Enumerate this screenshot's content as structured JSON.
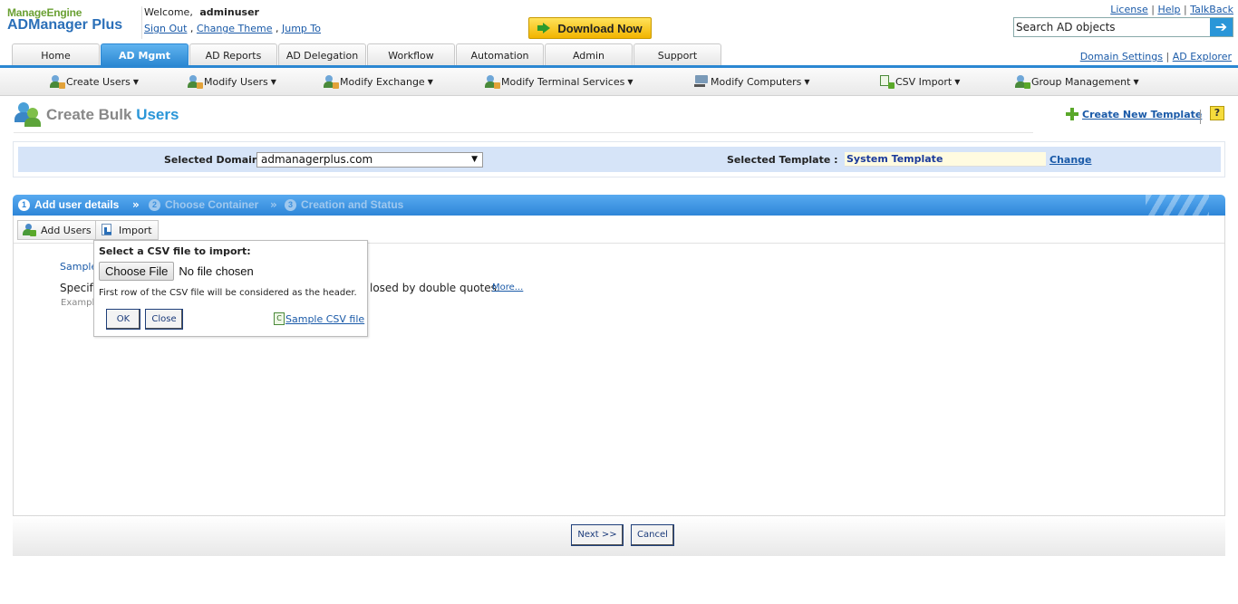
{
  "logo": {
    "top": "ManageEngine",
    "main": "ADManager",
    "plus": "Plus"
  },
  "welcome": {
    "text": "Welcome,",
    "user": "adminuser",
    "sign_out": "Sign Out",
    "sep1": " , ",
    "change_theme": "Change Theme",
    "sep2": " , ",
    "jump_to": "Jump To"
  },
  "download_label": "Download Now",
  "top_links": {
    "license": "License",
    "help": "Help",
    "talkback": "TalkBack",
    "sep": " | "
  },
  "search": {
    "value": "Search AD objects",
    "go_icon": "arrow-right-icon"
  },
  "tabs": [
    {
      "label": "Home"
    },
    {
      "label": "AD Mgmt"
    },
    {
      "label": "AD Reports"
    },
    {
      "label": "AD Delegation"
    },
    {
      "label": "Workflow"
    },
    {
      "label": "Automation"
    },
    {
      "label": "Admin"
    },
    {
      "label": "Support"
    }
  ],
  "tab_links": {
    "domain_settings": "Domain Settings",
    "sep": " | ",
    "ad_explorer": "AD Explorer"
  },
  "submenu": [
    {
      "label": "Create Users"
    },
    {
      "label": "Modify Users"
    },
    {
      "label": "Modify Exchange"
    },
    {
      "label": "Modify Terminal Services"
    },
    {
      "label": "Modify Computers"
    },
    {
      "label": "CSV Import"
    },
    {
      "label": "Group Management"
    }
  ],
  "page": {
    "title_prefix": "Create Bulk ",
    "title_highlight": "Users",
    "create_template": "Create New Template",
    "help": "?"
  },
  "domain": {
    "label": "Selected Domain:",
    "value": "admanagerplus.com",
    "template_label": "Selected Template :",
    "template_value": "System Template",
    "change": "Change"
  },
  "steps": [
    {
      "num": "1",
      "label": "Add user details"
    },
    {
      "num": "2",
      "label": "Choose Container"
    },
    {
      "num": "3",
      "label": "Creation and Status"
    }
  ],
  "step_sep": "»",
  "toolbar": {
    "add_users": "Add Users",
    "import": "Import"
  },
  "background": {
    "sample": "Sample",
    "specify": "Specify",
    "specify_rest": "losed by double quotes.",
    "more": "More...",
    "example": "Exampl"
  },
  "popup": {
    "title": "Select a CSV file to import:",
    "choose_file": "Choose File",
    "no_file": "No file chosen",
    "note": "First row of the CSV file will be considered as the header.",
    "ok": "OK",
    "close": "Close",
    "csv_icon_text": "C",
    "sample_csv": "Sample CSV file"
  },
  "footer": {
    "next": "Next >>",
    "cancel": "Cancel"
  }
}
